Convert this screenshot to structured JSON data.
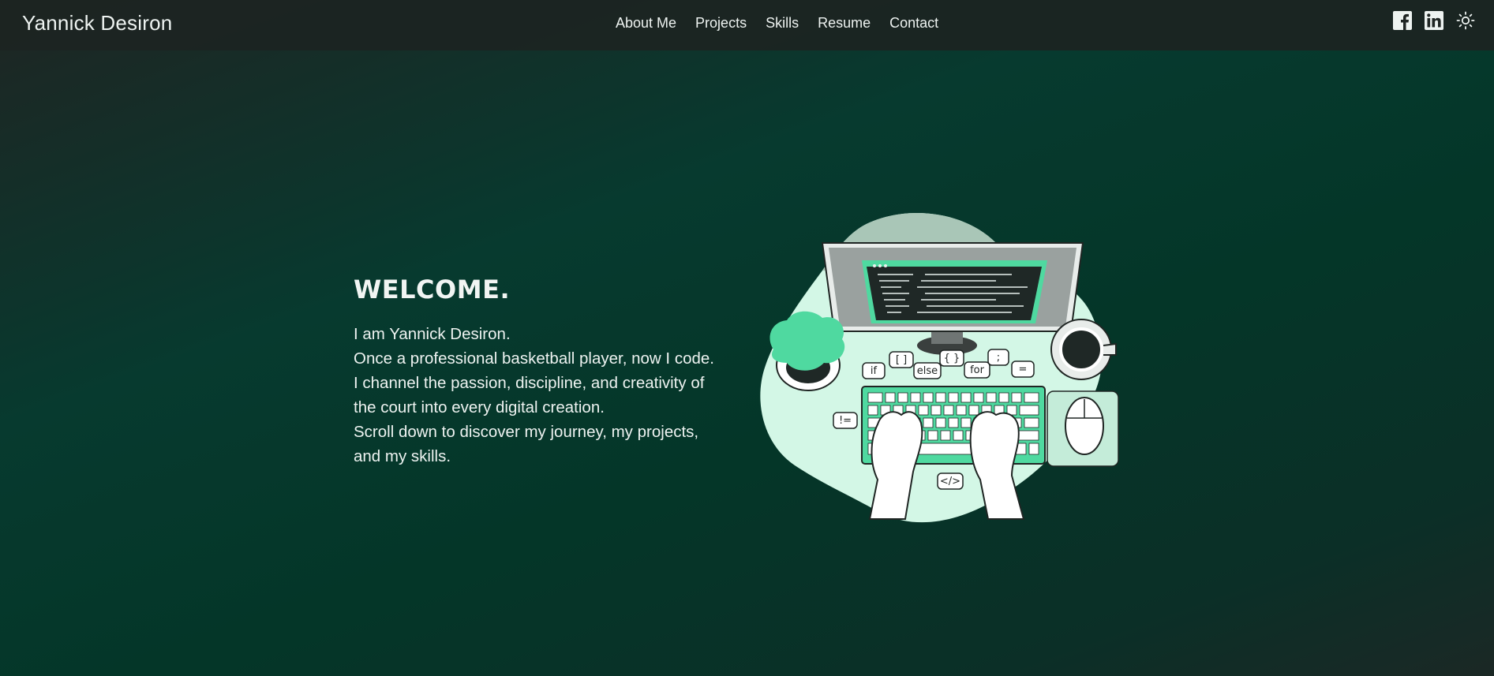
{
  "header": {
    "brand": "Yannick Desiron",
    "nav": [
      {
        "label": "About Me"
      },
      {
        "label": "Projects"
      },
      {
        "label": "Skills"
      },
      {
        "label": "Resume"
      },
      {
        "label": "Contact"
      }
    ],
    "icons": [
      "facebook-icon",
      "linkedin-icon",
      "sun-icon"
    ]
  },
  "hero": {
    "title": "WELCOME.",
    "lines": [
      "I am Yannick Desiron.",
      "Once a professional basketball player, now I code.",
      "I channel the passion, discipline, and creativity of",
      "the court into every digital creation.",
      "Scroll down to discover my journey, my projects,",
      "and my skills."
    ]
  },
  "illustration": {
    "bubbles": [
      "if",
      "[ ]",
      "else",
      "{ }",
      "for",
      ";",
      "=",
      "!=",
      "</>"
    ]
  },
  "colors": {
    "accent": "#4fd9a0",
    "blob": "#d3f7e6",
    "dark": "#1f2523"
  }
}
